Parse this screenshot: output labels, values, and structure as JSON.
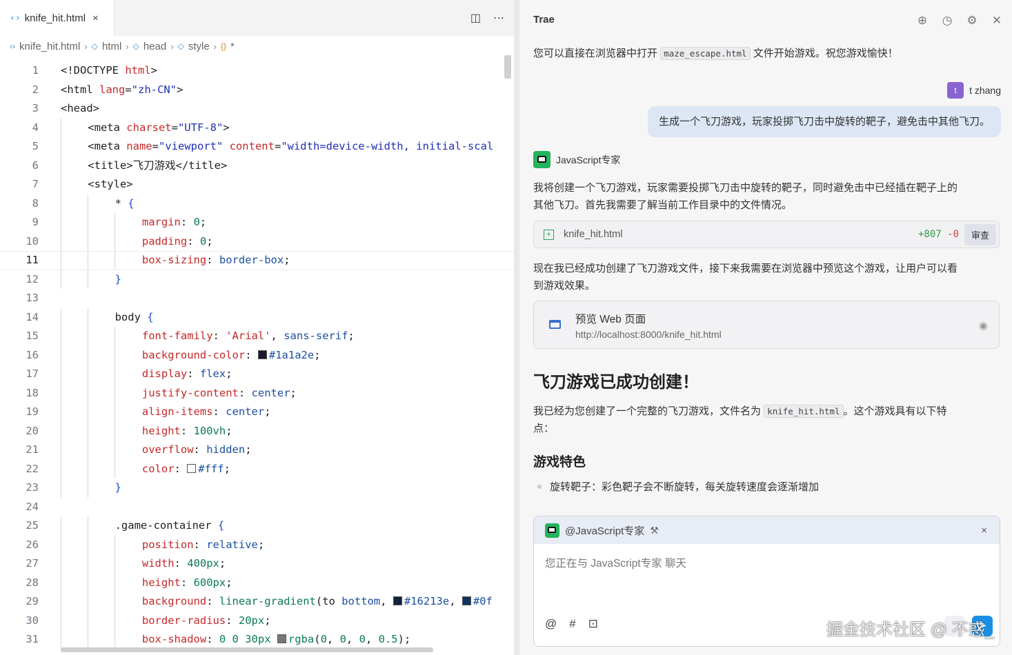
{
  "editor": {
    "tab": {
      "name": "knife_hit.html",
      "close": "×"
    },
    "tab_actions": {
      "split": "◫",
      "more": "⋯"
    },
    "breadcrumb": {
      "file": "knife_hit.html",
      "html": "html",
      "head": "head",
      "style": "style",
      "sel": "*"
    },
    "active_line": 11,
    "lines": [
      {
        "n": "1",
        "indent": 0,
        "tokens": [
          [
            "t-tag",
            "<!DOCTYPE "
          ],
          [
            "t-attr",
            "html"
          ],
          [
            "t-tag",
            ">"
          ]
        ]
      },
      {
        "n": "2",
        "indent": 0,
        "tokens": [
          [
            "t-tag",
            "<html "
          ],
          [
            "t-attr",
            "lang"
          ],
          [
            "t-tag",
            "="
          ],
          [
            "t-str",
            "\"zh-CN\""
          ],
          [
            "t-tag",
            ">"
          ]
        ]
      },
      {
        "n": "3",
        "indent": 0,
        "tokens": [
          [
            "t-tag",
            "<head>"
          ]
        ]
      },
      {
        "n": "4",
        "indent": 1,
        "tokens": [
          [
            "t-tag",
            "<meta "
          ],
          [
            "t-attr",
            "charset"
          ],
          [
            "t-tag",
            "="
          ],
          [
            "t-str",
            "\"UTF-8\""
          ],
          [
            "t-tag",
            ">"
          ]
        ]
      },
      {
        "n": "5",
        "indent": 1,
        "tokens": [
          [
            "t-tag",
            "<meta "
          ],
          [
            "t-attr",
            "name"
          ],
          [
            "t-tag",
            "="
          ],
          [
            "t-str",
            "\"viewport\""
          ],
          [
            "t-tag",
            " "
          ],
          [
            "t-attr",
            "content"
          ],
          [
            "t-tag",
            "="
          ],
          [
            "t-str",
            "\"width=device-width, initial-scal"
          ]
        ]
      },
      {
        "n": "6",
        "indent": 1,
        "tokens": [
          [
            "t-tag",
            "<title>飞刀游戏</title>"
          ]
        ]
      },
      {
        "n": "7",
        "indent": 1,
        "tokens": [
          [
            "t-tag",
            "<style>"
          ]
        ]
      },
      {
        "n": "8",
        "indent": 2,
        "tokens": [
          [
            "t-sel",
            "* "
          ],
          [
            "t-brace",
            "{"
          ]
        ]
      },
      {
        "n": "9",
        "indent": 3,
        "tokens": [
          [
            "t-prop",
            "margin"
          ],
          [
            "t-sel",
            ": "
          ],
          [
            "t-num",
            "0"
          ],
          [
            "t-sel",
            ";"
          ]
        ]
      },
      {
        "n": "10",
        "indent": 3,
        "tokens": [
          [
            "t-prop",
            "padding"
          ],
          [
            "t-sel",
            ": "
          ],
          [
            "t-num",
            "0"
          ],
          [
            "t-sel",
            ";"
          ]
        ]
      },
      {
        "n": "11",
        "indent": 3,
        "tokens": [
          [
            "t-prop",
            "box-sizing"
          ],
          [
            "t-sel",
            ": "
          ],
          [
            "t-val",
            "border-box"
          ],
          [
            "t-sel",
            ";"
          ]
        ]
      },
      {
        "n": "12",
        "indent": 2,
        "tokens": [
          [
            "t-brace",
            "}"
          ]
        ]
      },
      {
        "n": "13",
        "indent": 0,
        "tokens": []
      },
      {
        "n": "14",
        "indent": 2,
        "tokens": [
          [
            "t-sel",
            "body "
          ],
          [
            "t-brace",
            "{"
          ]
        ]
      },
      {
        "n": "15",
        "indent": 3,
        "tokens": [
          [
            "t-prop",
            "font-family"
          ],
          [
            "t-sel",
            ": "
          ],
          [
            "t-attr",
            "'Arial'"
          ],
          [
            "t-sel",
            ", "
          ],
          [
            "t-val",
            "sans-serif"
          ],
          [
            "t-sel",
            ";"
          ]
        ]
      },
      {
        "n": "16",
        "indent": 3,
        "tokens": [
          [
            "t-prop",
            "background-color"
          ],
          [
            "t-sel",
            ": "
          ],
          [
            "swatch:#1a1a2e",
            ""
          ],
          [
            "t-val",
            "#1a1a2e"
          ],
          [
            "t-sel",
            ";"
          ]
        ]
      },
      {
        "n": "17",
        "indent": 3,
        "tokens": [
          [
            "t-prop",
            "display"
          ],
          [
            "t-sel",
            ": "
          ],
          [
            "t-val",
            "flex"
          ],
          [
            "t-sel",
            ";"
          ]
        ]
      },
      {
        "n": "18",
        "indent": 3,
        "tokens": [
          [
            "t-prop",
            "justify-content"
          ],
          [
            "t-sel",
            ": "
          ],
          [
            "t-val",
            "center"
          ],
          [
            "t-sel",
            ";"
          ]
        ]
      },
      {
        "n": "19",
        "indent": 3,
        "tokens": [
          [
            "t-prop",
            "align-items"
          ],
          [
            "t-sel",
            ": "
          ],
          [
            "t-val",
            "center"
          ],
          [
            "t-sel",
            ";"
          ]
        ]
      },
      {
        "n": "20",
        "indent": 3,
        "tokens": [
          [
            "t-prop",
            "height"
          ],
          [
            "t-sel",
            ": "
          ],
          [
            "t-num",
            "100vh"
          ],
          [
            "t-sel",
            ";"
          ]
        ]
      },
      {
        "n": "21",
        "indent": 3,
        "tokens": [
          [
            "t-prop",
            "overflow"
          ],
          [
            "t-sel",
            ": "
          ],
          [
            "t-val",
            "hidden"
          ],
          [
            "t-sel",
            ";"
          ]
        ]
      },
      {
        "n": "22",
        "indent": 3,
        "tokens": [
          [
            "t-prop",
            "color"
          ],
          [
            "t-sel",
            ": "
          ],
          [
            "swatch:#ffffff",
            ""
          ],
          [
            "t-val",
            "#fff"
          ],
          [
            "t-sel",
            ";"
          ]
        ]
      },
      {
        "n": "23",
        "indent": 2,
        "tokens": [
          [
            "t-brace",
            "}"
          ]
        ]
      },
      {
        "n": "24",
        "indent": 0,
        "tokens": []
      },
      {
        "n": "25",
        "indent": 2,
        "tokens": [
          [
            "t-sel",
            ".game-container "
          ],
          [
            "t-brace",
            "{"
          ]
        ]
      },
      {
        "n": "26",
        "indent": 3,
        "tokens": [
          [
            "t-prop",
            "position"
          ],
          [
            "t-sel",
            ": "
          ],
          [
            "t-val",
            "relative"
          ],
          [
            "t-sel",
            ";"
          ]
        ]
      },
      {
        "n": "27",
        "indent": 3,
        "tokens": [
          [
            "t-prop",
            "width"
          ],
          [
            "t-sel",
            ": "
          ],
          [
            "t-num",
            "400px"
          ],
          [
            "t-sel",
            ";"
          ]
        ]
      },
      {
        "n": "28",
        "indent": 3,
        "tokens": [
          [
            "t-prop",
            "height"
          ],
          [
            "t-sel",
            ": "
          ],
          [
            "t-num",
            "600px"
          ],
          [
            "t-sel",
            ";"
          ]
        ]
      },
      {
        "n": "29",
        "indent": 3,
        "tokens": [
          [
            "t-prop",
            "background"
          ],
          [
            "t-sel",
            ": "
          ],
          [
            "t-num",
            "linear-gradient"
          ],
          [
            "t-sel",
            "("
          ],
          [
            "t-sel",
            "to "
          ],
          [
            "t-val",
            "bottom"
          ],
          [
            "t-sel",
            ", "
          ],
          [
            "swatch:#16213e",
            ""
          ],
          [
            "t-val",
            "#16213e"
          ],
          [
            "t-sel",
            ", "
          ],
          [
            "swatch:#0f3460",
            ""
          ],
          [
            "t-val",
            "#0f"
          ]
        ]
      },
      {
        "n": "30",
        "indent": 3,
        "tokens": [
          [
            "t-prop",
            "border-radius"
          ],
          [
            "t-sel",
            ": "
          ],
          [
            "t-num",
            "20px"
          ],
          [
            "t-sel",
            ";"
          ]
        ]
      },
      {
        "n": "31",
        "indent": 3,
        "tokens": [
          [
            "t-prop",
            "box-shadow"
          ],
          [
            "t-sel",
            ": "
          ],
          [
            "t-num",
            "0 0 30px "
          ],
          [
            "swatch:#777777",
            ""
          ],
          [
            "t-num",
            "rgba"
          ],
          [
            "t-sel",
            "("
          ],
          [
            "t-num",
            "0"
          ],
          [
            "t-sel",
            ", "
          ],
          [
            "t-num",
            "0"
          ],
          [
            "t-sel",
            ", "
          ],
          [
            "t-num",
            "0"
          ],
          [
            "t-sel",
            ", "
          ],
          [
            "t-num",
            "0.5"
          ],
          [
            "t-sel",
            ");"
          ]
        ]
      }
    ]
  },
  "chat": {
    "title": "Trae",
    "actions": {
      "new": "⊕",
      "history": "◷",
      "settings": "⚙",
      "close": "✕"
    },
    "msg1": {
      "before": "您可以直接在浏览器中打开 ",
      "code": "maze_escape.html",
      "after": " 文件开始游戏。祝您游戏愉快！"
    },
    "user": {
      "avatar": "t",
      "name": "t zhang",
      "message": "生成一个飞刀游戏，玩家投掷飞刀击中旋转的靶子，避免击中其他飞刀。"
    },
    "agent": {
      "name": "JavaScript专家"
    },
    "msg2_l1": "我将创建一个飞刀游戏，玩家需要投掷飞刀击中旋转的靶子，同时避免击中已经插在靶子上的",
    "msg2_l2": "其他飞刀。首先我需要了解当前工作目录中的文件情况。",
    "file_card": {
      "name": "knife_hit.html",
      "added": "+807",
      "removed": "-0",
      "review": "审查"
    },
    "msg3_l1": "现在我已经成功创建了飞刀游戏文件，接下来我需要在浏览器中预览这个游戏，让用户可以看",
    "msg3_l2": "到游戏效果。",
    "preview": {
      "title": "预览 Web 页面",
      "url": "http://localhost:8000/knife_hit.html"
    },
    "heading": "飞刀游戏已成功创建！",
    "msg4": {
      "before": "我已经为您创建了一个完整的飞刀游戏，文件名为 ",
      "code": "knife_hit.html",
      "after": "。这个游戏具有以下特",
      "l2": "点："
    },
    "subheading": "游戏特色",
    "bullet1": "旋转靶子：彩色靶子会不断旋转，每关旋转速度会逐渐增加",
    "input": {
      "mention": "@JavaScript专家",
      "placeholder": "您正在与 JavaScript专家 聊天",
      "close": "×",
      "tool_at": "@",
      "tool_hash": "#",
      "tool_image": "⊡",
      "send": "➤"
    },
    "watermark": "掘金技术社区 @ 不惑_"
  }
}
